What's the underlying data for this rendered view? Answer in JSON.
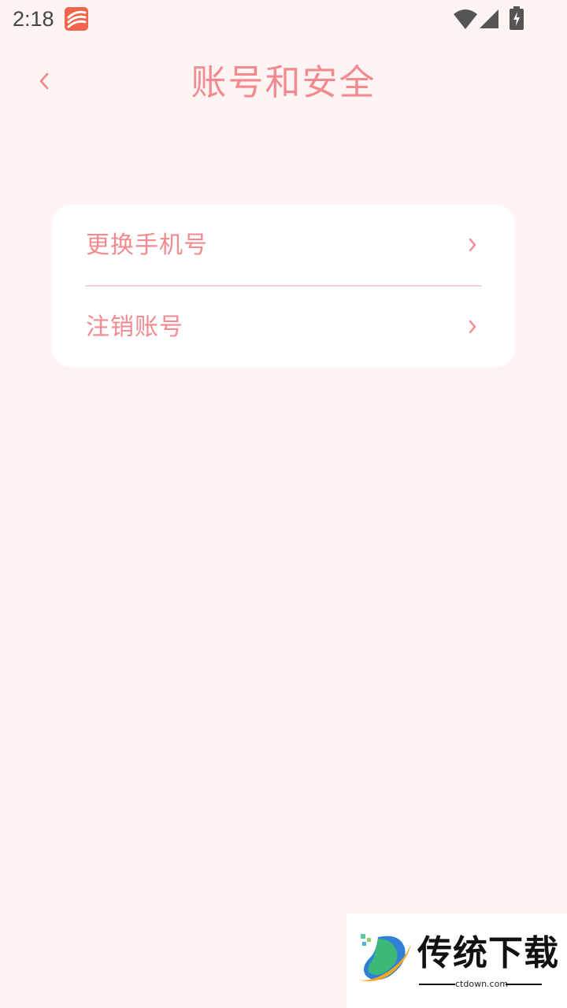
{
  "status_bar": {
    "time": "2:18",
    "icons": [
      "app-notification-icon",
      "wifi-icon",
      "cellular-signal-icon",
      "battery-charging-icon"
    ]
  },
  "header": {
    "back_icon": "chevron-left-icon",
    "title": "账号和安全"
  },
  "menu": {
    "items": [
      {
        "label": "更换手机号",
        "icon": "chevron-right-icon"
      },
      {
        "label": "注销账号",
        "icon": "chevron-right-icon"
      }
    ]
  },
  "watermark": {
    "title": "传统下载",
    "url": "ctdown.com"
  },
  "colors": {
    "background": "#fff4f4",
    "accent": "#f28a8f",
    "card": "#ffffff",
    "divider": "#f6cfd1"
  }
}
